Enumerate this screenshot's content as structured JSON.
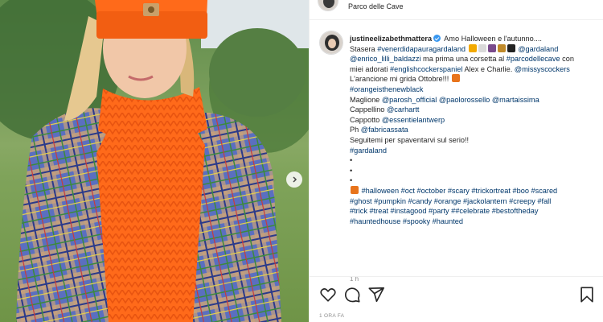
{
  "header": {
    "location": "Parco delle Cave"
  },
  "caption": {
    "username": "justineelizabethmattera",
    "lines": [
      {
        "parts": [
          {
            "t": " Amo Halloween e l'autunno....",
            "c": ""
          }
        ]
      },
      {
        "parts": [
          {
            "t": "Stasera ",
            "c": ""
          },
          {
            "t": "#venerdidapauragardaland",
            "c": "link"
          },
          {
            "t": " ",
            "c": ""
          },
          {
            "e": "#f2a900"
          },
          {
            "e": "#d9d9d9"
          },
          {
            "e": "#7a4b8c"
          },
          {
            "e": "#c08a2a"
          },
          {
            "e": "#222222"
          },
          {
            "t": " ",
            "c": ""
          },
          {
            "t": "@gardaland",
            "c": "link"
          }
        ]
      },
      {
        "parts": [
          {
            "t": "@enrico_lilli_baldazzi",
            "c": "link"
          },
          {
            "t": " ma prima una corsetta al ",
            "c": ""
          },
          {
            "t": "#parcodellecave",
            "c": "link"
          },
          {
            "t": " con",
            "c": ""
          }
        ]
      },
      {
        "parts": [
          {
            "t": "miei adorati ",
            "c": ""
          },
          {
            "t": "#englishcockerspaniel",
            "c": "link"
          },
          {
            "t": " Alex e Charlie. ",
            "c": ""
          },
          {
            "t": "@missyscockers",
            "c": "link"
          }
        ]
      },
      {
        "parts": [
          {
            "t": "L'arancione mi grida Ottobre!!! ",
            "c": ""
          },
          {
            "e": "#e8741c"
          }
        ]
      },
      {
        "parts": [
          {
            "t": "#orangeisthenewblack",
            "c": "link"
          }
        ]
      },
      {
        "parts": [
          {
            "t": "Maglione ",
            "c": ""
          },
          {
            "t": "@parosh_official",
            "c": "link"
          },
          {
            "t": " ",
            "c": ""
          },
          {
            "t": "@paolorossello",
            "c": "link"
          },
          {
            "t": " ",
            "c": ""
          },
          {
            "t": "@martaissima",
            "c": "link"
          }
        ]
      },
      {
        "parts": [
          {
            "t": "Cappellino ",
            "c": ""
          },
          {
            "t": "@carhartt",
            "c": "link"
          }
        ]
      },
      {
        "parts": [
          {
            "t": "Cappotto ",
            "c": ""
          },
          {
            "t": "@essentielantwerp",
            "c": "link"
          }
        ]
      },
      {
        "parts": [
          {
            "t": "Ph ",
            "c": ""
          },
          {
            "t": "@fabricassata",
            "c": "link"
          }
        ]
      },
      {
        "parts": [
          {
            "t": "Seguitemi per spaventarvi sul serio!!",
            "c": ""
          }
        ]
      },
      {
        "parts": [
          {
            "t": "#gardaland",
            "c": "link"
          }
        ]
      },
      {
        "parts": [
          {
            "t": "•",
            "c": ""
          }
        ]
      },
      {
        "parts": [
          {
            "t": "•",
            "c": ""
          }
        ]
      },
      {
        "parts": [
          {
            "t": "•",
            "c": ""
          }
        ]
      },
      {
        "parts": [
          {
            "e": "#e8741c"
          },
          {
            "t": " ",
            "c": ""
          },
          {
            "t": "#halloween #oct #october #scary #trickortreat #boo #scared",
            "c": "link"
          }
        ]
      },
      {
        "parts": [
          {
            "t": "#ghost #pumpkin #candy #orange #jackolantern #creepy #fall",
            "c": "link"
          }
        ]
      },
      {
        "parts": [
          {
            "t": "#trick #treat #instagood #party ##celebrate #bestoftheday",
            "c": "link"
          }
        ]
      },
      {
        "parts": [
          {
            "t": "#hauntedhouse #spooky #haunted",
            "c": "link"
          }
        ]
      }
    ],
    "time": "1 h"
  },
  "actions": {
    "like_icon": "heart-icon",
    "comment_icon": "comment-icon",
    "share_icon": "share-icon",
    "save_icon": "bookmark-icon"
  },
  "date": "1 ORA FA",
  "colors": {
    "link": "#00376b",
    "verified": "#3897f0",
    "muted": "#8e8e8e"
  }
}
